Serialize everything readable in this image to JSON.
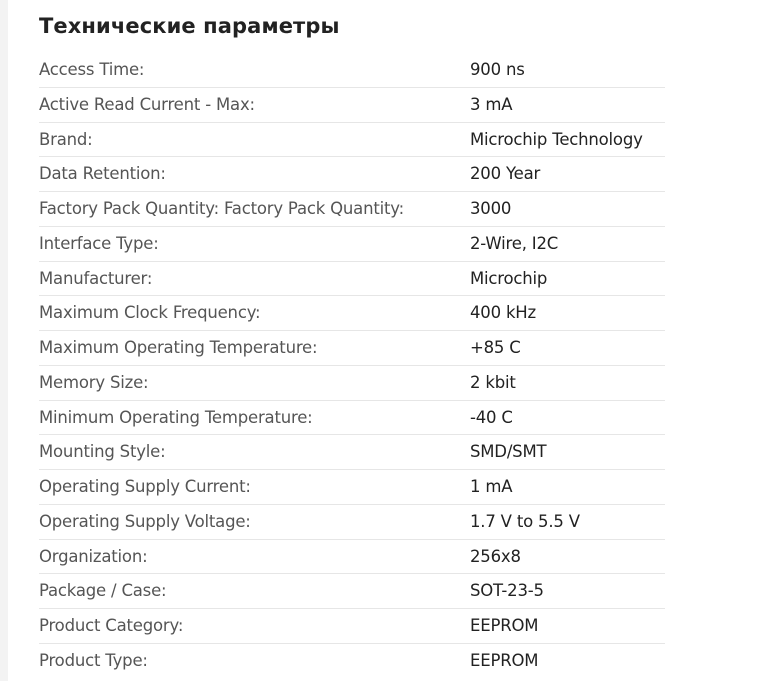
{
  "section": {
    "title": "Технические параметры"
  },
  "specs": [
    {
      "label": "Access Time:",
      "value": "900 ns"
    },
    {
      "label": "Active Read Current - Max:",
      "value": "3 mA"
    },
    {
      "label": "Brand:",
      "value": "Microchip Technology"
    },
    {
      "label": "Data Retention:",
      "value": "200 Year"
    },
    {
      "label": "Factory Pack Quantity: Factory Pack Quantity:",
      "value": "3000"
    },
    {
      "label": "Interface Type:",
      "value": "2-Wire, I2C"
    },
    {
      "label": "Manufacturer:",
      "value": "Microchip"
    },
    {
      "label": "Maximum Clock Frequency:",
      "value": "400 kHz"
    },
    {
      "label": "Maximum Operating Temperature:",
      "value": "+85 C"
    },
    {
      "label": "Memory Size:",
      "value": "2 kbit"
    },
    {
      "label": "Minimum Operating Temperature:",
      "value": "-40 C"
    },
    {
      "label": "Mounting Style:",
      "value": "SMD/SMT"
    },
    {
      "label": "Operating Supply Current:",
      "value": "1 mA"
    },
    {
      "label": "Operating Supply Voltage:",
      "value": "1.7 V to 5.5 V"
    },
    {
      "label": "Organization:",
      "value": "256x8"
    },
    {
      "label": "Package / Case:",
      "value": "SOT-23-5"
    },
    {
      "label": "Product Category:",
      "value": "EEPROM"
    },
    {
      "label": "Product Type:",
      "value": "EEPROM"
    }
  ]
}
